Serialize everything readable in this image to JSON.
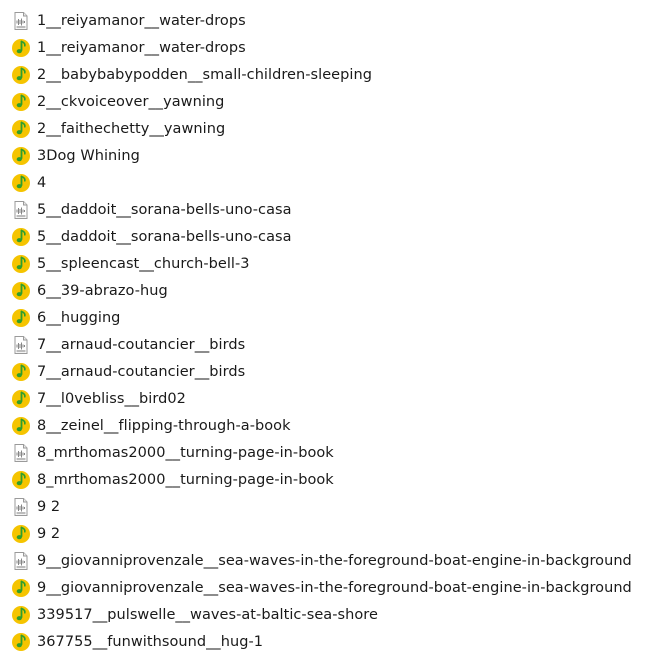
{
  "files": [
    {
      "name": "1__reiyamanor__water-drops",
      "icon": "wav-file-icon"
    },
    {
      "name": "1__reiyamanor__water-drops",
      "icon": "music-note-icon"
    },
    {
      "name": "2__babybabypodden__small-children-sleeping",
      "icon": "music-note-icon"
    },
    {
      "name": "2__ckvoiceover__yawning",
      "icon": "music-note-icon"
    },
    {
      "name": "2__faithechetty__yawning",
      "icon": "music-note-icon"
    },
    {
      "name": "3Dog Whining",
      "icon": "music-note-icon"
    },
    {
      "name": "4",
      "icon": "music-note-icon"
    },
    {
      "name": "5__daddoit__sorana-bells-uno-casa",
      "icon": "wav-file-icon"
    },
    {
      "name": "5__daddoit__sorana-bells-uno-casa",
      "icon": "music-note-icon"
    },
    {
      "name": "5__spleencast__church-bell-3",
      "icon": "music-note-icon"
    },
    {
      "name": "6__39-abrazo-hug",
      "icon": "music-note-icon"
    },
    {
      "name": "6__hugging",
      "icon": "music-note-icon"
    },
    {
      "name": "7__arnaud-coutancier__birds",
      "icon": "wav-file-icon"
    },
    {
      "name": "7__arnaud-coutancier__birds",
      "icon": "music-note-icon"
    },
    {
      "name": "7__l0vebliss__bird02",
      "icon": "music-note-icon"
    },
    {
      "name": "8__zeinel__flipping-through-a-book",
      "icon": "music-note-icon"
    },
    {
      "name": "8_mrthomas2000__turning-page-in-book",
      "icon": "wav-file-icon"
    },
    {
      "name": "8_mrthomas2000__turning-page-in-book",
      "icon": "music-note-icon"
    },
    {
      "name": "9 2",
      "icon": "wav-file-icon"
    },
    {
      "name": "9 2",
      "icon": "music-note-icon"
    },
    {
      "name": "9__giovanniprovenzale__sea-waves-in-the-foreground-boat-engine-in-background",
      "icon": "wav-file-icon"
    },
    {
      "name": "9__giovanniprovenzale__sea-waves-in-the-foreground-boat-engine-in-background",
      "icon": "music-note-icon"
    },
    {
      "name": "339517__pulswelle__waves-at-baltic-sea-shore",
      "icon": "music-note-icon"
    },
    {
      "name": "367755__funwithsound__hug-1",
      "icon": "music-note-icon"
    }
  ],
  "colors": {
    "music_icon_fill": "#f5c400",
    "music_icon_note": "#2e9e2e",
    "wav_icon_page": "#ffffff",
    "wav_icon_border": "#9a9a9a",
    "text": "#1a1a1a"
  }
}
